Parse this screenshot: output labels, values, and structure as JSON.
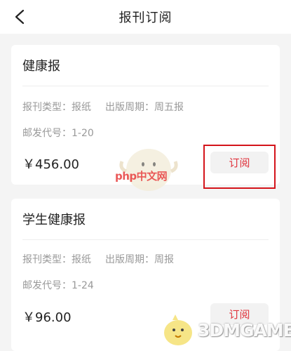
{
  "header": {
    "title": "报刊订阅",
    "back_icon": "chevron-left-icon"
  },
  "cards": [
    {
      "title": "健康报",
      "type_label": "报刊类型：",
      "type_value": "报纸",
      "period_label": "出版周期：",
      "period_value": "周五报",
      "code_label": "邮发代号：",
      "code_value": "1-20",
      "price": "￥456.00",
      "button_label": "订阅"
    },
    {
      "title": "学生健康报",
      "type_label": "报刊类型：",
      "type_value": "报纸",
      "period_label": "出版周期：",
      "period_value": "周报",
      "code_label": "邮发代号：",
      "code_value": "1-24",
      "price": "￥96.00",
      "button_label": "订阅"
    }
  ],
  "watermarks": {
    "php": "php中文网",
    "game": "3DMGAME"
  },
  "colors": {
    "accent": "#e0333c",
    "highlight": "#d4141b",
    "background": "#f4f4f4"
  }
}
